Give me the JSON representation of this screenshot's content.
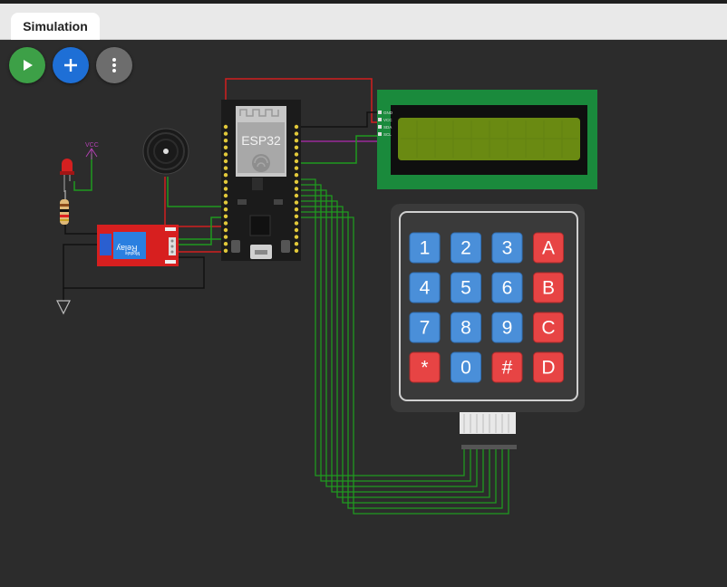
{
  "tab": {
    "label": "Simulation"
  },
  "toolbar": {
    "run_icon": "play-icon",
    "add_icon": "plus-icon",
    "more_icon": "more-vertical-icon"
  },
  "colors": {
    "canvas": "#2c2c2c",
    "run": "#3da047",
    "add": "#1e6fd6",
    "more": "#6d6d6d",
    "wire_green": "#1f9a1f",
    "wire_red": "#d11f1f",
    "wire_purple": "#9a2a9a",
    "lcd_board": "#1a8a3c",
    "relay_board": "#d71f1f",
    "key_blue": "#4a8fd9",
    "key_red": "#e74444"
  },
  "board": {
    "label": "ESP32"
  },
  "vcc": {
    "label": "VCC"
  },
  "relay": {
    "line1": "Relay",
    "line2": "Module"
  },
  "lcd": {
    "pins": [
      "GND",
      "VCC",
      "SDA",
      "SCL"
    ]
  },
  "keypad": {
    "keys": [
      [
        "1",
        "2",
        "3",
        "A"
      ],
      [
        "4",
        "5",
        "6",
        "B"
      ],
      [
        "7",
        "8",
        "9",
        "C"
      ],
      [
        "*",
        "0",
        "#",
        "D"
      ]
    ]
  }
}
